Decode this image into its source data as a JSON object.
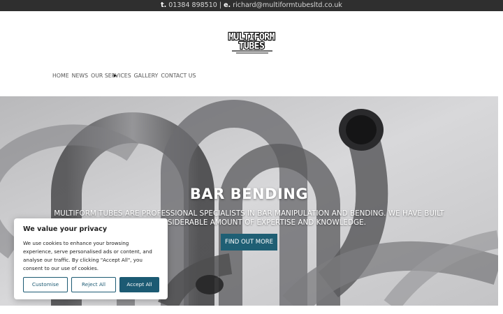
{
  "topbar": {
    "phone_prefix": "t.",
    "phone": "01384 898510",
    "separator": "|",
    "email_prefix": "e.",
    "email": "richard@multiformtubesltd.co.uk"
  },
  "logo": {
    "line1": "MULTIFORM",
    "line2": "TUBES"
  },
  "nav": {
    "items": [
      "HOME",
      "NEWS",
      "OUR SERVICES",
      "GALLERY",
      "CONTACT US"
    ]
  },
  "hero": {
    "title": "BAR BENDING",
    "text": "MULTIFORM TUBES ARE PROFESSIONAL SPECIALISTS IN BAR MANIPULATION AND BENDING. WE HAVE BUILT UP A CONSIDERABLE AMOUNT OF EXPERTISE AND KNOWLEDGE.",
    "button": "FIND OUT MORE"
  },
  "cookie": {
    "title": "We value your privacy",
    "body": "We use cookies to enhance your browsing experience, serve personalised ads or content, and analyse our traffic. By clicking \"Accept All\", you consent to our use of cookies.",
    "customise": "Customise",
    "reject": "Reject All",
    "accept": "Accept All"
  },
  "colors": {
    "topbar_bg": "#2f2f2f",
    "button_bg": "#1f5f74",
    "cookie_accent": "#1c5a73"
  }
}
